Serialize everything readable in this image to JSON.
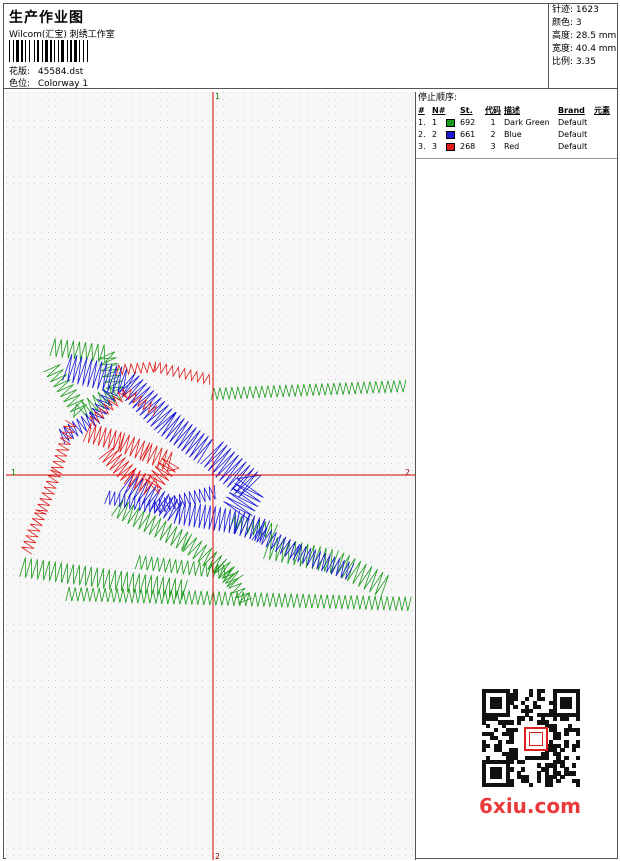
{
  "header": {
    "title": "生产作业图",
    "company": "Wilcom(汇宝) 刺绣工作室",
    "design_label": "花版:",
    "design_value": "45584.dst",
    "colorway_label": "色位:",
    "colorway_value": "Colorway 1"
  },
  "stats": {
    "stitches": "针迹: 1623",
    "colors": "颜色: 3",
    "height": "高度: 28.5 mm",
    "width": "宽度: 40.4 mm",
    "scale": "比例: 3.35"
  },
  "axes": {
    "top": "1",
    "bottom": "2",
    "left": "1",
    "right": "2"
  },
  "sequence": {
    "title": "停止顺序:",
    "headers": {
      "num": "#",
      "n": "N#",
      "st": "St.",
      "code": "代码",
      "desc": "描述",
      "brand": "Brand",
      "element": "元素"
    },
    "rows": [
      {
        "num": "1.",
        "n": "1",
        "color": "#1a9a1a",
        "st": "692",
        "code": "1",
        "desc": "Dark Green",
        "brand": "Default"
      },
      {
        "num": "2.",
        "n": "2",
        "color": "#1a1ad8",
        "st": "661",
        "code": "2",
        "desc": "Blue",
        "brand": "Default"
      },
      {
        "num": "3.",
        "n": "3",
        "color": "#e01a1a",
        "st": "268",
        "code": "3",
        "desc": "Red",
        "brand": "Default"
      }
    ]
  },
  "watermark": {
    "site": "6xiu.com",
    "icon": "qr-code-icon"
  }
}
